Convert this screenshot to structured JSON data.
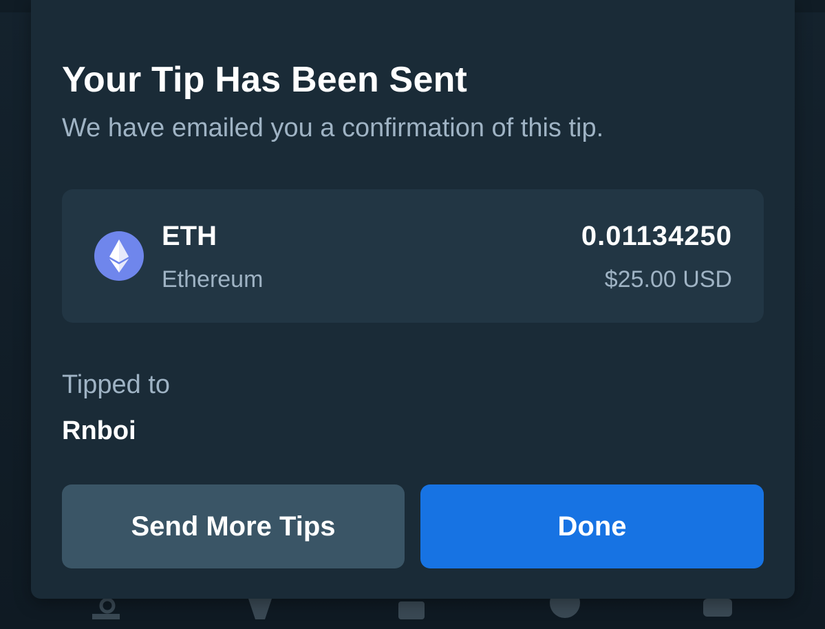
{
  "modal": {
    "title": "Your Tip Has Been Sent",
    "subtitle": "We have emailed you a confirmation of this tip."
  },
  "coin": {
    "icon": "ethereum-icon",
    "symbol": "ETH",
    "name": "Ethereum",
    "amount": "0.01134250",
    "usd_value": "$25.00 USD",
    "icon_color": "#6f86ec"
  },
  "recipient": {
    "label": "Tipped to",
    "username": "Rnboi"
  },
  "actions": {
    "send_more_label": "Send More Tips",
    "done_label": "Done"
  },
  "bottom_nav": {
    "icons": [
      "search-icon",
      "tag-icon",
      "list-icon",
      "basketball-icon",
      "chat-icon"
    ]
  },
  "colors": {
    "background": "#0f1b24",
    "modal": "#1a2b37",
    "card": "#223644",
    "primary_button": "#1773e3",
    "secondary_button": "#3a5566",
    "muted_text": "#9fb3c4"
  }
}
